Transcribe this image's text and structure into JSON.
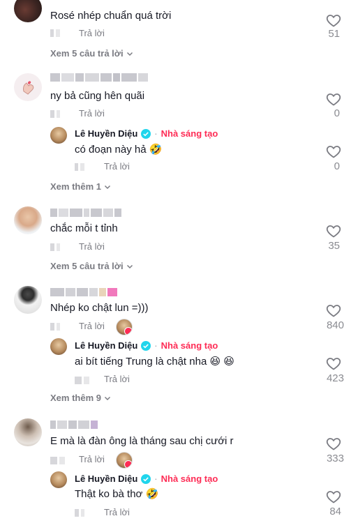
{
  "labels": {
    "reply": "Trả lời",
    "creator_badge": "Nhà sáng tạo",
    "dot": "·"
  },
  "creator": {
    "name": "Lê Huyền Diệu"
  },
  "comments": [
    {
      "text": "Rosé nhép chuẩn quá trời",
      "likes": "51",
      "more": "Xem 5 câu trả lời"
    },
    {
      "text": "ny bả cũng hên quãi",
      "likes": "0",
      "reply": {
        "text": "có đoạn này hả 🤣",
        "likes": "0"
      },
      "more": "Xem thêm 1"
    },
    {
      "text": "chắc mỗi t tỉnh",
      "likes": "35",
      "more": "Xem 5 câu trả lời"
    },
    {
      "text": "Nhép ko chật lun =)))",
      "likes": "840",
      "reply": {
        "text": "ai bít tiếng Trung là chật nha 😆 😆",
        "likes": "423"
      },
      "more": "Xem thêm 9"
    },
    {
      "text": "E mà là đàn ông là tháng sau chị cưới r",
      "likes": "333",
      "reply": {
        "text": "Thật ko bà thơ 🤣",
        "likes": "84"
      }
    }
  ],
  "colors": {
    "accent": "#fe2c55",
    "verified": "#20d5ec",
    "text": "#161823",
    "muted": "#7a7b82"
  },
  "icons": [
    "heart-outline-icon",
    "chevron-down-icon",
    "verified-check-icon",
    "creator-liked-icon"
  ]
}
